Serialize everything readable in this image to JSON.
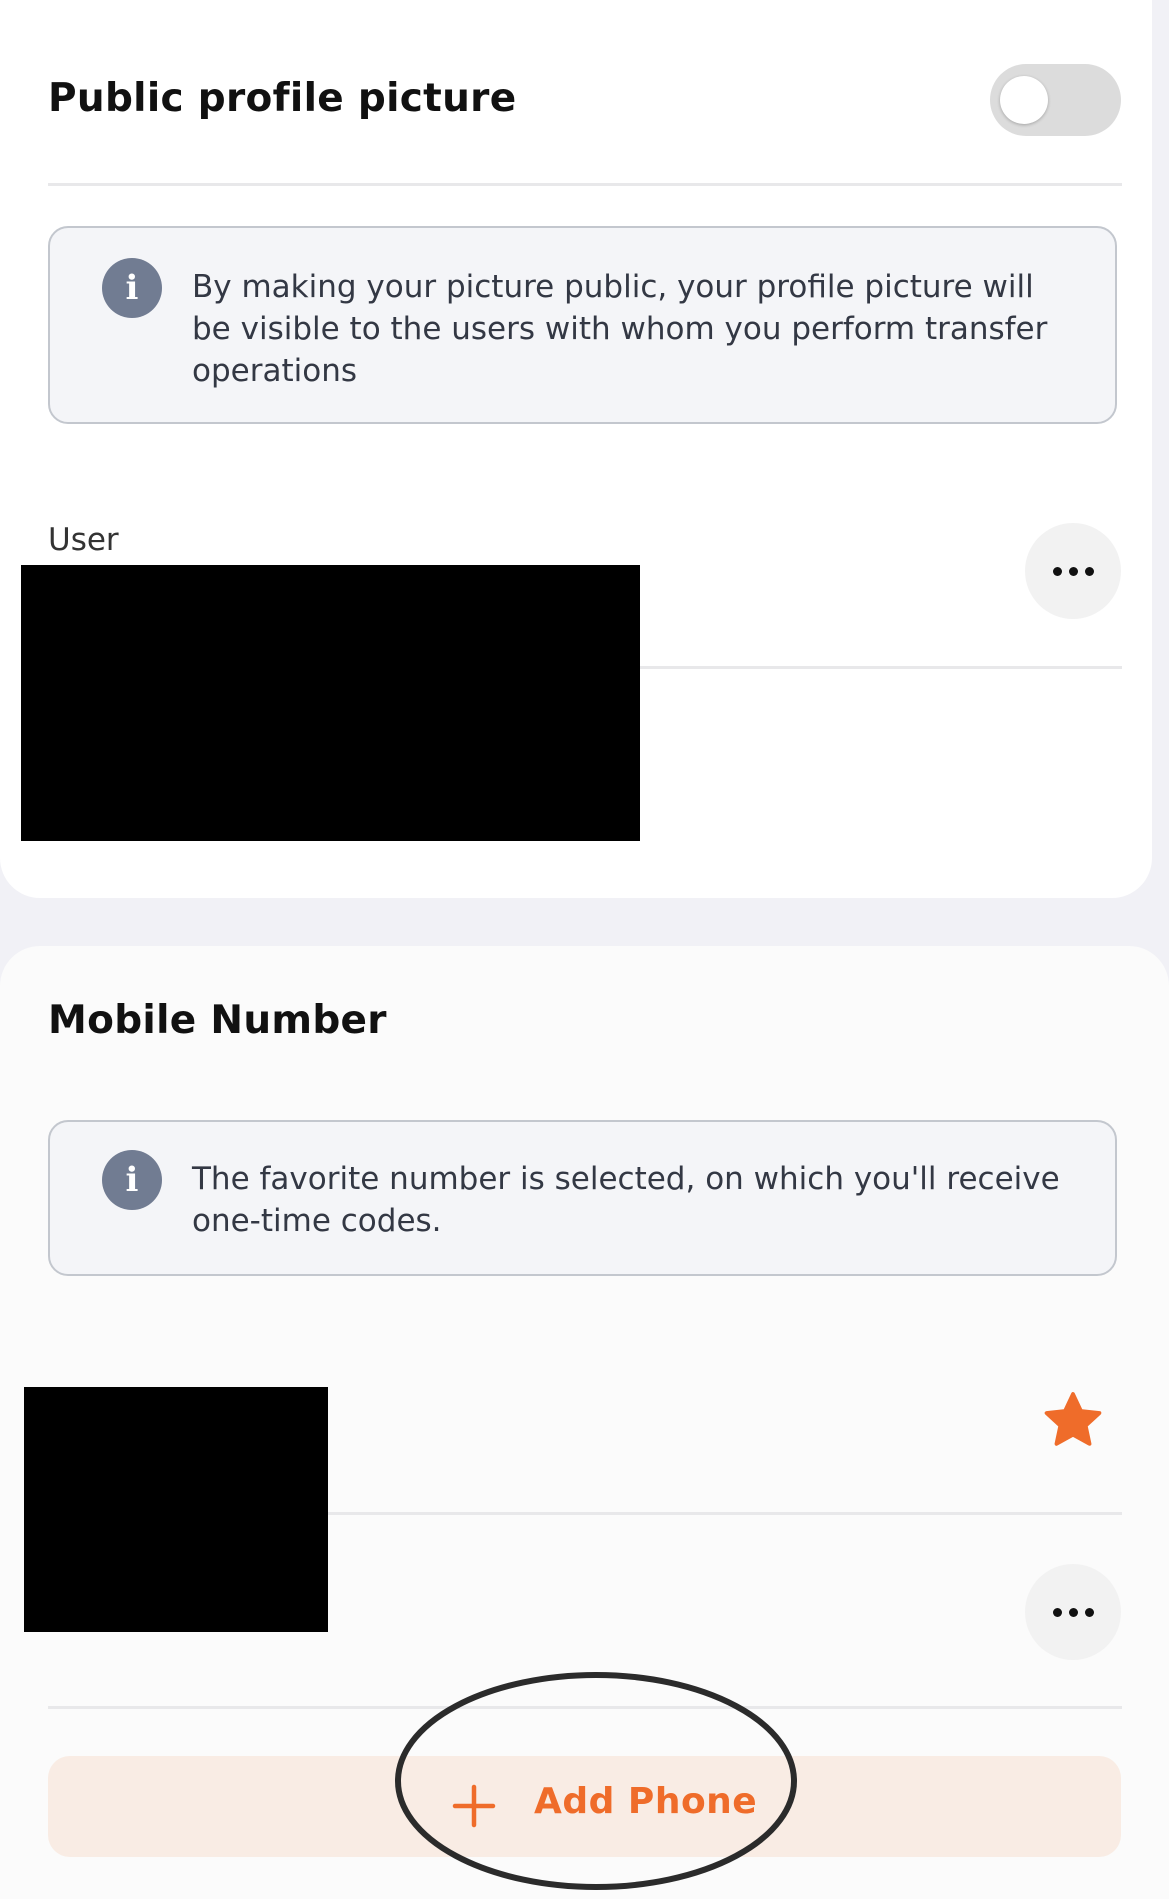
{
  "profile_picture": {
    "title": "Public profile picture",
    "toggle_on": false,
    "info_text": "By making your picture public, your profile picture will be visible to the users with whom you perform transfer operations"
  },
  "user": {
    "label": "User",
    "more_icon": "more-horizontal-icon"
  },
  "mobile": {
    "title": "Mobile Number",
    "info_text": "The favorite number is selected, on which you'll receive one-time codes.",
    "favorite_icon": "star-icon",
    "more_icon": "more-horizontal-icon",
    "add_button_label": "Add Phone",
    "add_icon": "plus-icon"
  },
  "colors": {
    "accent": "#ef6c2a",
    "info_icon_bg": "#717c92",
    "add_button_bg": "#f9ece4"
  }
}
